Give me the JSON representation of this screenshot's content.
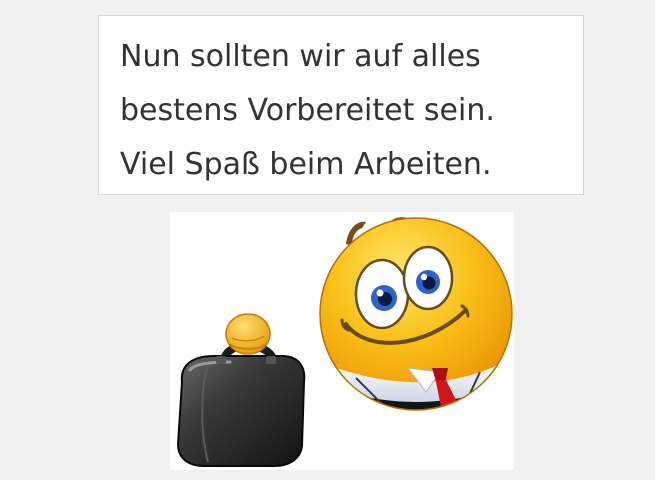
{
  "message": {
    "lines": [
      "Nun sollten wir auf alles",
      "bestens Vorbereitet sein.",
      "Viel Spaß beim Arbeiten."
    ]
  },
  "illustration": {
    "icon": "smiley-with-briefcase-icon",
    "colors": {
      "face": "#f7b90d",
      "briefcase": "#2e2e2e",
      "tie": "#d0161b",
      "eyes": "#2f63c6"
    }
  }
}
